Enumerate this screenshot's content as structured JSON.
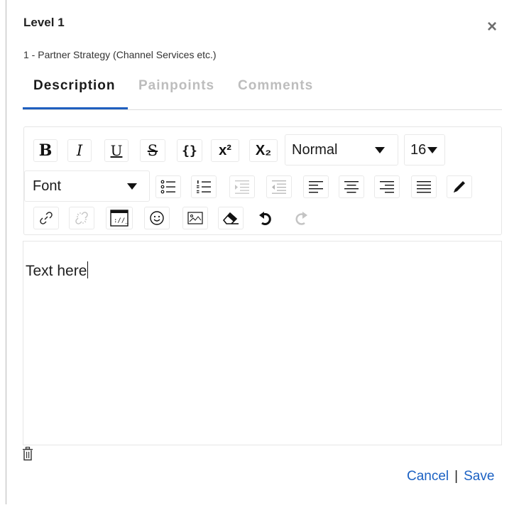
{
  "header": {
    "title": "Level 1",
    "subtitle": "1 - Partner Strategy (Channel Services etc.)",
    "close_label": "×"
  },
  "tabs": [
    {
      "label": "Description",
      "active": true
    },
    {
      "label": "Painpoints",
      "active": false
    },
    {
      "label": "Comments",
      "active": false
    }
  ],
  "toolbar": {
    "bold_label": "B",
    "italic_label": "I",
    "underline_label": "U",
    "strike_label": "S",
    "code_label": "{}",
    "superscript_label": "x²",
    "subscript_label": "X₂",
    "heading_select": {
      "value": "Normal"
    },
    "size_select": {
      "value": "16"
    },
    "font_select": {
      "value": "Font"
    },
    "icons": [
      "bullet-list-icon",
      "numbered-list-icon",
      "indent-icon",
      "outdent-icon",
      "align-left-icon",
      "align-center-icon",
      "align-right-icon",
      "align-justify-icon",
      "text-color-icon",
      "link-icon",
      "unlink-icon",
      "embed-icon",
      "emoji-icon",
      "image-icon",
      "eraser-icon",
      "undo-icon",
      "redo-icon"
    ]
  },
  "editor": {
    "content": "Text here"
  },
  "footer": {
    "cancel_label": "Cancel",
    "separator": "|",
    "save_label": "Save"
  },
  "colors": {
    "accent": "#1f5fbf",
    "link": "#1b61c3",
    "inactive_tab": "#bdbdbd"
  }
}
